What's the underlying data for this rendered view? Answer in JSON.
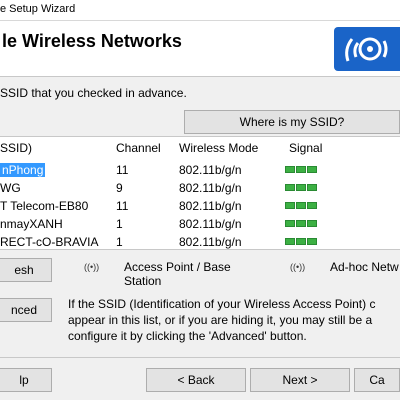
{
  "window": {
    "title": "e Setup Wizard"
  },
  "header": {
    "title": "le Wireless Networks"
  },
  "instruction": "SSID that you checked in advance.",
  "where_button": "Where is my SSID?",
  "columns": {
    "ssid": "SSID)",
    "channel": "Channel",
    "mode": "Wireless Mode",
    "signal": "Signal"
  },
  "networks": [
    {
      "ssid": "nPhong",
      "channel": "11",
      "mode": "802.11b/g/n",
      "signal_bars": 3,
      "selected": true
    },
    {
      "ssid": "WG",
      "channel": "9",
      "mode": "802.11b/g/n",
      "signal_bars": 3,
      "selected": false
    },
    {
      "ssid": "T Telecom-EB80",
      "channel": "11",
      "mode": "802.11b/g/n",
      "signal_bars": 3,
      "selected": false
    },
    {
      "ssid": "nmayXANH",
      "channel": "1",
      "mode": "802.11b/g/n",
      "signal_bars": 3,
      "selected": false
    },
    {
      "ssid": "RECT-cO-BRAVIA",
      "channel": "1",
      "mode": "802.11b/g/n",
      "signal_bars": 3,
      "selected": false
    }
  ],
  "legend": {
    "access_point": "Access Point / Base Station",
    "adhoc": "Ad-hoc Netw"
  },
  "buttons": {
    "refresh": "esh",
    "advanced": "nced",
    "help": "lp",
    "back": "< Back",
    "next": "Next >",
    "cancel": "Ca"
  },
  "note": "If the SSID (Identification of your Wireless Access Point) c appear in this list, or if you are hiding it, you may still be a configure it by clicking the 'Advanced' button.",
  "colors": {
    "selection": "#3399ff",
    "signal": "#3cb043",
    "logo": "#1a64c8"
  }
}
